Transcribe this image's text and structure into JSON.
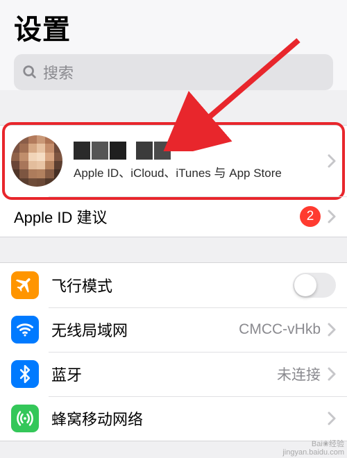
{
  "header": {
    "title": "设置",
    "search_placeholder": "搜索"
  },
  "profile": {
    "subtitle": "Apple ID、iCloud、iTunes 与 App Store"
  },
  "suggestions": {
    "label": "Apple ID 建议",
    "badge": "2"
  },
  "rows": {
    "airplane": {
      "label": "飞行模式"
    },
    "wifi": {
      "label": "无线局域网",
      "value": "CMCC-vHkb"
    },
    "bluetooth": {
      "label": "蓝牙",
      "value": "未连接"
    },
    "cellular": {
      "label": "蜂窝移动网络"
    }
  },
  "annotation": {
    "highlight_color": "#e8262c"
  },
  "watermark": {
    "line1": "Bai❀经验",
    "line2": "jingyan.baidu.com"
  }
}
